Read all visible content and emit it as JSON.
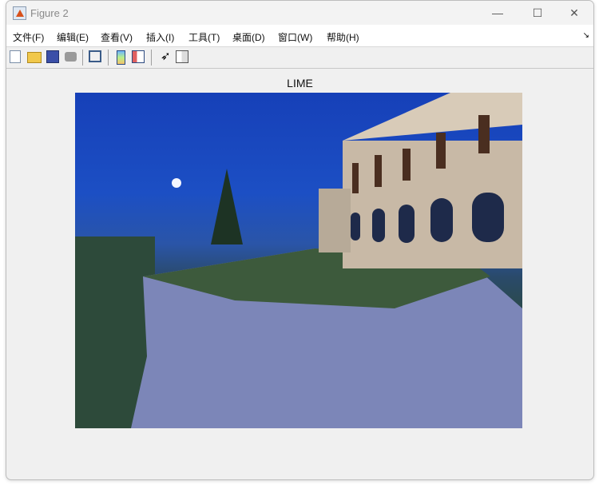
{
  "window": {
    "title": "Figure 2",
    "minimize": "—",
    "maximize": "☐",
    "close": "✕"
  },
  "menu": [
    "文件(F)",
    "编辑(E)",
    "查看(V)",
    "插入(I)",
    "工具(T)",
    "桌面(D)",
    "窗口(W)",
    "帮助(H)"
  ],
  "dock_icon": "↘",
  "toolbar": [
    "new-figure-icon",
    "open-file-icon",
    "save-icon",
    "print-icon",
    "link-plot-icon",
    "colorbar-icon",
    "legend-icon",
    "pointer-icon",
    "property-editor-icon"
  ],
  "axes": {
    "title": "LIME"
  }
}
